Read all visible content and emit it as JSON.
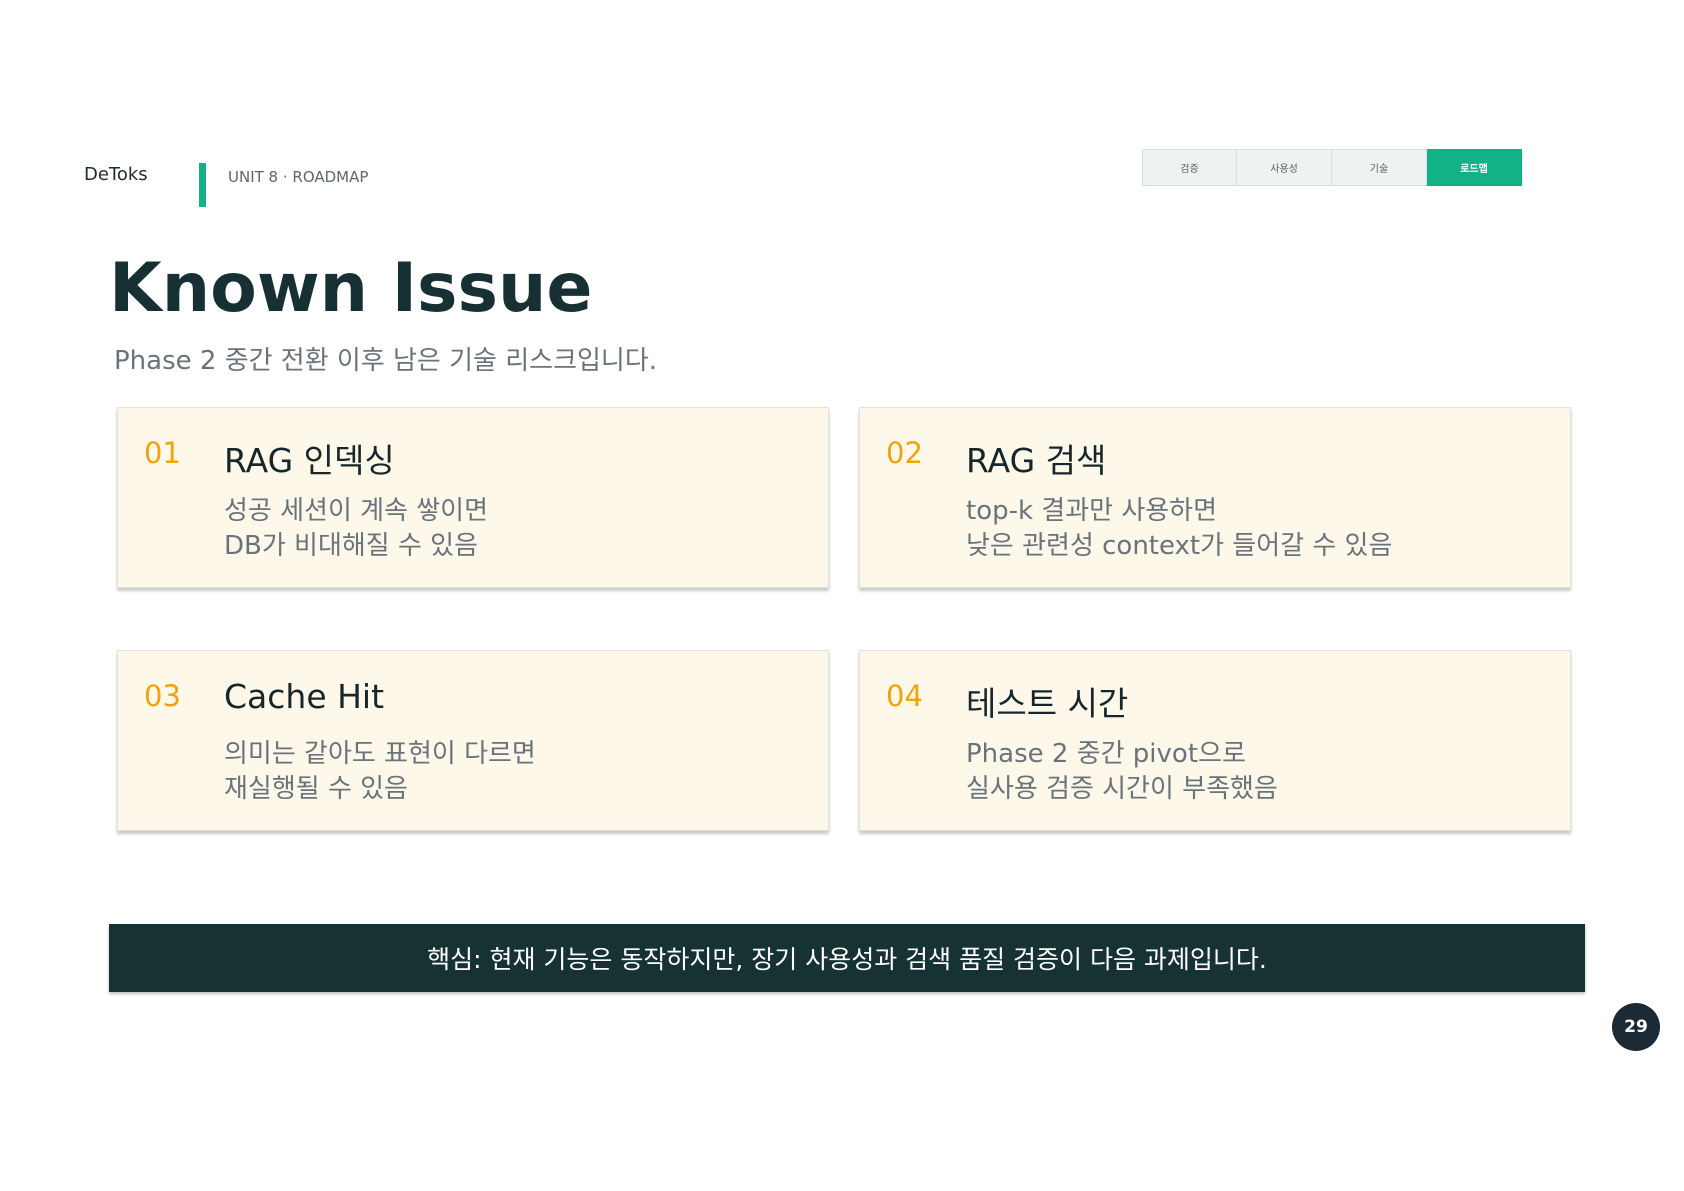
{
  "header": {
    "brand": "DeToks",
    "unit": "UNIT 8 · ROADMAP",
    "accent_color": "#12b286"
  },
  "tabs": [
    {
      "label": "검증",
      "active": false
    },
    {
      "label": "사용성",
      "active": false
    },
    {
      "label": "기술",
      "active": false
    },
    {
      "label": "로드맵",
      "active": true
    }
  ],
  "main": {
    "title": "Known Issue",
    "subtitle": "Phase 2 중간 전환 이후 남은 기술 리스크입니다."
  },
  "cards": [
    {
      "num": "01",
      "title": "RAG 인덱싱",
      "lines": [
        "성공 세션이 계속 쌓이면",
        "DB가 비대해질 수 있음"
      ]
    },
    {
      "num": "02",
      "title": "RAG 검색",
      "lines": [
        "top-k 결과만 사용하면",
        "낮은 관련성 context가 들어갈 수 있음"
      ]
    },
    {
      "num": "03",
      "title": "Cache Hit",
      "lines": [
        "의미는 같아도 표현이 다르면",
        "재실행될 수 있음"
      ]
    },
    {
      "num": "04",
      "title": "테스트 시간",
      "lines": [
        "Phase 2 중간 pivot으로",
        "실사용 검증 시간이 부족했음"
      ]
    }
  ],
  "banner": {
    "text": "핵심: 현재 기능은 동작하지만, 장기 사용성과 검색 품질 검증이 다음 과제입니다."
  },
  "page_number": "29"
}
